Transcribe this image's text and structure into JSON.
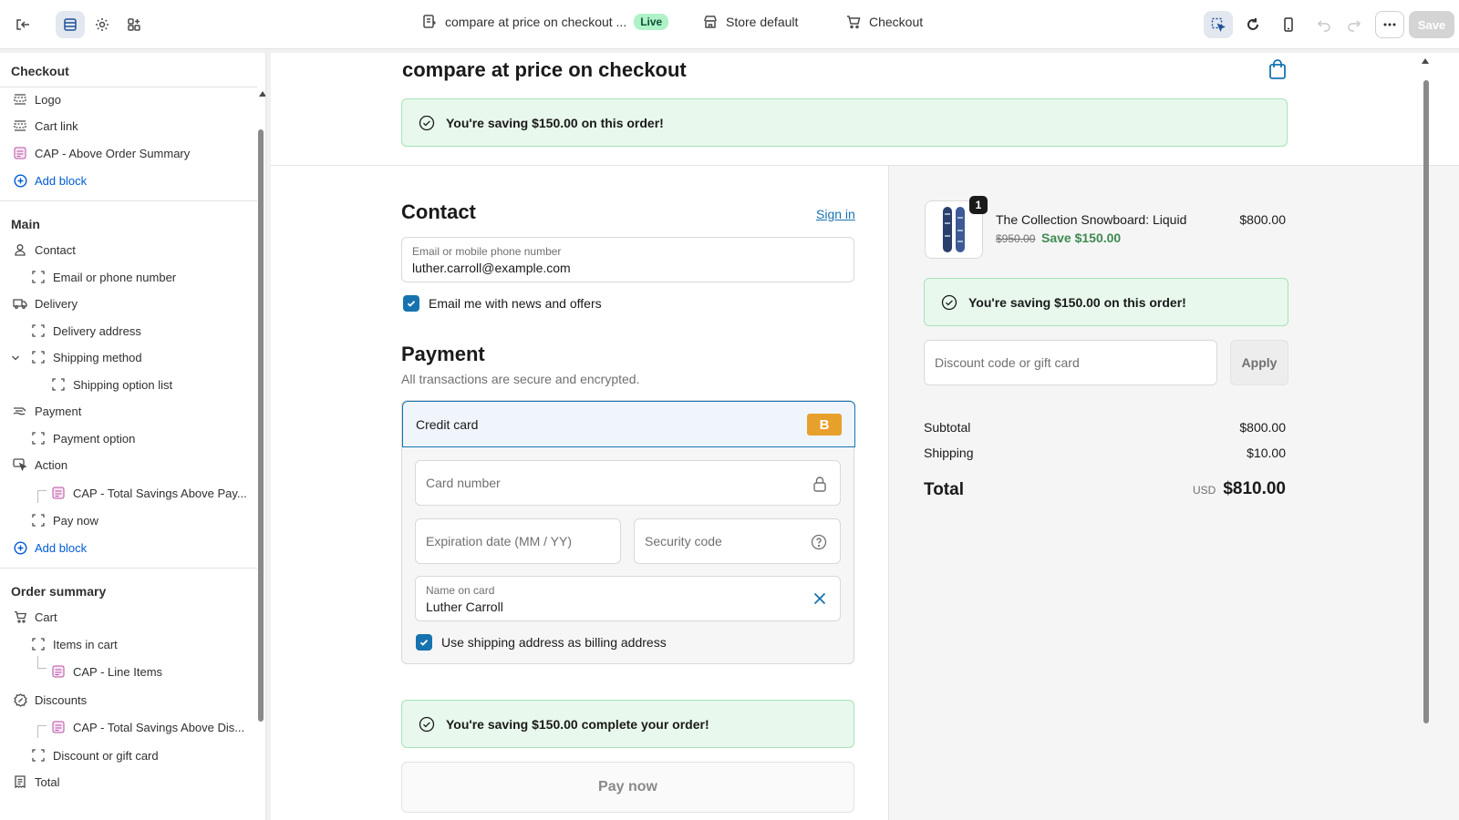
{
  "topbar": {
    "theme_name": "compare at price on checkout ...",
    "status_badge": "Live",
    "store_context": "Store default",
    "page_context": "Checkout",
    "save_label": "Save"
  },
  "sidebar": {
    "title": "Checkout",
    "header_items": [
      {
        "label": "Logo"
      },
      {
        "label": "Cart link"
      },
      {
        "label": "CAP - Above Order Summary"
      }
    ],
    "add_block": "Add block",
    "main_title": "Main",
    "main_items": [
      {
        "label": "Contact"
      },
      {
        "label": "Email or phone number"
      },
      {
        "label": "Delivery"
      },
      {
        "label": "Delivery address"
      },
      {
        "label": "Shipping method"
      },
      {
        "label": "Shipping option list"
      },
      {
        "label": "Payment"
      },
      {
        "label": "Payment option"
      },
      {
        "label": "Action"
      },
      {
        "label": "CAP - Total Savings Above Pay..."
      },
      {
        "label": "Pay now"
      }
    ],
    "summary_title": "Order summary",
    "summary_items": [
      {
        "label": "Cart"
      },
      {
        "label": "Items in cart"
      },
      {
        "label": "CAP - Line Items"
      },
      {
        "label": "Discounts"
      },
      {
        "label": "CAP - Total Savings Above Dis..."
      },
      {
        "label": "Discount or gift card"
      },
      {
        "label": "Total"
      }
    ]
  },
  "preview": {
    "shop_title": "compare at price on checkout",
    "top_banner": "You're saving $150.00 on this order!",
    "contact": {
      "heading": "Contact",
      "sign_in": "Sign in",
      "email_label": "Email or mobile phone number",
      "email_value": "luther.carroll@example.com",
      "news_checkbox": "Email me with news and offers"
    },
    "payment": {
      "heading": "Payment",
      "subtitle": "All transactions are secure and encrypted.",
      "method": "Credit card",
      "method_badge": "B",
      "card_number_ph": "Card number",
      "expiry_ph": "Expiration date (MM / YY)",
      "security_ph": "Security code",
      "name_label": "Name on card",
      "name_value": "Luther Carroll",
      "billing_checkbox": "Use shipping address as billing address"
    },
    "bottom_banner": "You're saving $150.00 complete your order!",
    "pay_now": "Pay now",
    "summary": {
      "qty_badge": "1",
      "product_name": "The Collection Snowboard: Liquid",
      "compare_price": "$950.00",
      "save_text": "Save $150.00",
      "price": "$800.00",
      "banner": "You're saving $150.00 on this order!",
      "discount_ph": "Discount code or gift card",
      "apply": "Apply",
      "subtotal_label": "Subtotal",
      "subtotal_value": "$800.00",
      "shipping_label": "Shipping",
      "shipping_value": "$10.00",
      "total_label": "Total",
      "currency": "USD",
      "total_value": "$810.00"
    }
  },
  "colors": {
    "accent": "#1773b0",
    "success_bg": "#e8f8ec",
    "success_border": "#a6e3b8",
    "badge_orange": "#e8a02c",
    "app_block_purple": "#b34fa3"
  }
}
